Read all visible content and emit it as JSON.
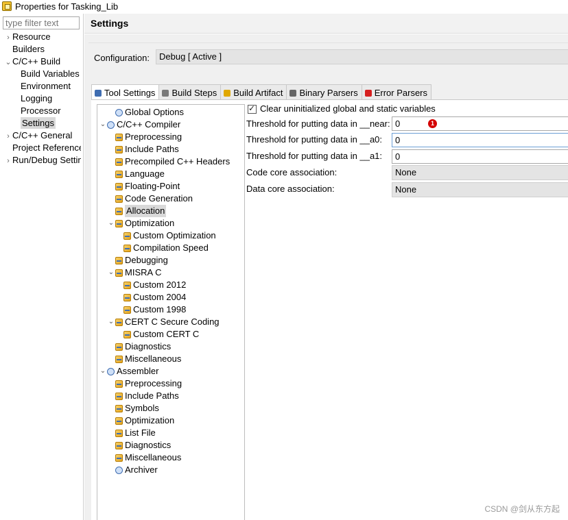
{
  "window": {
    "title": "Properties for Tasking_Lib"
  },
  "left_nav": {
    "filter_placeholder": "type filter text",
    "items": [
      {
        "label": "Resource",
        "arrow": "›"
      },
      {
        "label": "Builders",
        "arrow": ""
      },
      {
        "label": "C/C++ Build",
        "arrow": "⌄"
      },
      {
        "label": "Build Variables",
        "arrow": ""
      },
      {
        "label": "Environment",
        "arrow": ""
      },
      {
        "label": "Logging",
        "arrow": ""
      },
      {
        "label": "Processor",
        "arrow": ""
      },
      {
        "label": "Settings",
        "arrow": ""
      },
      {
        "label": "C/C++ General",
        "arrow": "›"
      },
      {
        "label": "Project References",
        "arrow": ""
      },
      {
        "label": "Run/Debug Settings",
        "arrow": "›"
      }
    ]
  },
  "header": {
    "title": "Settings"
  },
  "configuration": {
    "label": "Configuration:",
    "value": "Debug  [ Active ]"
  },
  "tabs": [
    {
      "label": "Tool Settings",
      "icon": "tool-settings-icon",
      "color": "#3f6db1"
    },
    {
      "label": "Build Steps",
      "icon": "wrench-icon",
      "color": "#7a7a7a"
    },
    {
      "label": "Build Artifact",
      "icon": "trophy-icon",
      "color": "#e0a800"
    },
    {
      "label": "Binary Parsers",
      "icon": "binary-icon",
      "color": "#666666"
    },
    {
      "label": "Error Parsers",
      "icon": "error-icon",
      "color": "#d62020"
    }
  ],
  "tree": [
    {
      "label": "Global Options",
      "exp": "",
      "type": "tool"
    },
    {
      "label": "C/C++ Compiler",
      "exp": "⌄",
      "type": "tool"
    },
    {
      "label": "Preprocessing",
      "exp": "",
      "type": "opt"
    },
    {
      "label": "Include Paths",
      "exp": "",
      "type": "opt"
    },
    {
      "label": "Precompiled C++ Headers",
      "exp": "",
      "type": "opt"
    },
    {
      "label": "Language",
      "exp": "",
      "type": "opt"
    },
    {
      "label": "Floating-Point",
      "exp": "",
      "type": "opt"
    },
    {
      "label": "Code Generation",
      "exp": "",
      "type": "opt"
    },
    {
      "label": "Allocation",
      "exp": "",
      "type": "opt"
    },
    {
      "label": "Optimization",
      "exp": "⌄",
      "type": "opt"
    },
    {
      "label": "Custom Optimization",
      "exp": "",
      "type": "opt"
    },
    {
      "label": "Compilation Speed",
      "exp": "",
      "type": "opt"
    },
    {
      "label": "Debugging",
      "exp": "",
      "type": "opt"
    },
    {
      "label": "MISRA C",
      "exp": "⌄",
      "type": "opt"
    },
    {
      "label": "Custom 2012",
      "exp": "",
      "type": "opt"
    },
    {
      "label": "Custom 2004",
      "exp": "",
      "type": "opt"
    },
    {
      "label": "Custom 1998",
      "exp": "",
      "type": "opt"
    },
    {
      "label": "CERT C Secure Coding",
      "exp": "⌄",
      "type": "opt"
    },
    {
      "label": "Custom CERT C",
      "exp": "",
      "type": "opt"
    },
    {
      "label": "Diagnostics",
      "exp": "",
      "type": "opt"
    },
    {
      "label": "Miscellaneous",
      "exp": "",
      "type": "opt"
    },
    {
      "label": "Assembler",
      "exp": "⌄",
      "type": "tool"
    },
    {
      "label": "Preprocessing",
      "exp": "",
      "type": "opt"
    },
    {
      "label": "Include Paths",
      "exp": "",
      "type": "opt"
    },
    {
      "label": "Symbols",
      "exp": "",
      "type": "opt"
    },
    {
      "label": "Optimization",
      "exp": "",
      "type": "opt"
    },
    {
      "label": "List File",
      "exp": "",
      "type": "opt"
    },
    {
      "label": "Diagnostics",
      "exp": "",
      "type": "opt"
    },
    {
      "label": "Miscellaneous",
      "exp": "",
      "type": "opt"
    },
    {
      "label": "Archiver",
      "exp": "",
      "type": "tool"
    }
  ],
  "settings": {
    "clear_uninit": {
      "label": "Clear uninitialized global and static variables",
      "checked": true
    },
    "near": {
      "label": "Threshold for putting data in __near:",
      "value": "0"
    },
    "a0": {
      "label": "Threshold for putting data in __a0:",
      "value": "0"
    },
    "a1": {
      "label": "Threshold for putting data in __a1:",
      "value": "0"
    },
    "code_core": {
      "label": "Code core association:",
      "value": "None"
    },
    "data_core": {
      "label": "Data core association:",
      "value": "None"
    }
  },
  "annotation_badge": "1",
  "watermark": "CSDN @剑从东方起"
}
